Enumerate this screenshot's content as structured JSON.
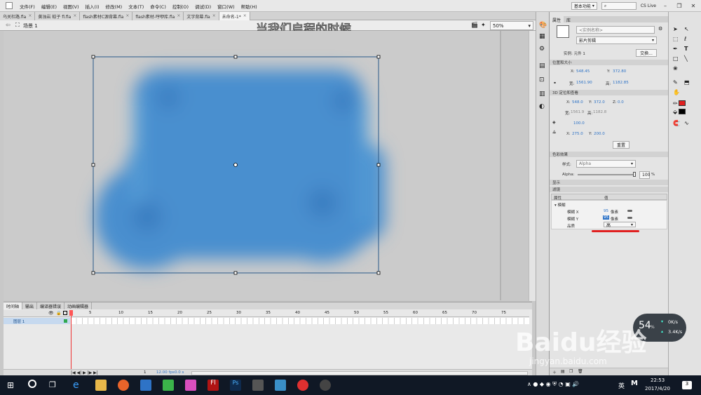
{
  "menubar": {
    "items": [
      "文件(F)",
      "编辑(E)",
      "视图(V)",
      "插入(I)",
      "修改(M)",
      "文本(T)",
      "命令(C)",
      "控制(O)",
      "调试(D)",
      "窗口(W)",
      "帮助(H)"
    ],
    "workspace": "基本功能",
    "search_placeholder": "",
    "cs_live": "CS Live"
  },
  "tabs": [
    {
      "label": "乌关杜路.fla",
      "active": false
    },
    {
      "label": "黄浊岩 蚊子 fl.fla",
      "active": false
    },
    {
      "label": "flash素材C源背幕.fla",
      "active": false
    },
    {
      "label": "flash素材-哼咿库.fla",
      "active": false
    },
    {
      "label": "文字背幕.fla",
      "active": false
    },
    {
      "label": "未命名-1*",
      "active": true
    }
  ],
  "scene": {
    "label": "场景 1",
    "overlay_title": "当我们启程的时候",
    "zoom": "50%"
  },
  "timeline": {
    "tabs": [
      "时间轴",
      "输出",
      "编译器错误",
      "动画编辑器"
    ],
    "layer_name": "图层 1",
    "frame_numbers": [
      "5",
      "10",
      "15",
      "20",
      "25",
      "30",
      "35",
      "40",
      "45",
      "50",
      "55",
      "60",
      "65",
      "70",
      "75"
    ],
    "status": {
      "frame": "1",
      "fps": "12.00 fps",
      "time": "0.0 s"
    }
  },
  "properties": {
    "tab_props": "属性",
    "tab_lib": "库",
    "instance_placeholder": "<实例名称>",
    "type": "影片剪辑",
    "instance_label": "实例: 元件 1",
    "swap_button": "交换...",
    "pos_section": "位置和大小",
    "x_label": "X:",
    "x_value": "548.45",
    "y_label": "Y:",
    "y_value": "372.80",
    "w_label": "宽:",
    "w_value": "1561.90",
    "h_label": "高:",
    "h_value": "1182.85",
    "three_d_section": "3D 定位和查看",
    "x3d": "548.0",
    "y3d": "372.0",
    "z3d": "0.0",
    "w3d": "1561.9",
    "h3d": "1182.8",
    "persp": "100.0",
    "vp_x": "275.0",
    "vp_y": "200.0",
    "reset_button": "重置",
    "color_section": "色彩效果",
    "style_label": "样式:",
    "style_value": "Alpha",
    "alpha_label": "Alpha:",
    "alpha_value": "100",
    "alpha_unit": "%",
    "display_section": "显示",
    "filters_section": "滤镜",
    "filter_col_prop": "属性",
    "filter_col_val": "值",
    "filter_name": "模糊",
    "blur_x_label": "模糊 X",
    "blur_x_value": "95",
    "blur_x_unit": "像素",
    "blur_y_label": "模糊 Y",
    "blur_y_value": "95",
    "blur_y_unit": "像素",
    "quality_label": "品质",
    "quality_value": "高"
  },
  "netwidget": {
    "percent": "54",
    "percent_unit": "%",
    "down": "0K/s",
    "up": "3.4K/s"
  },
  "watermark": {
    "brand": "Baidu经验",
    "url": "jingyan.baidu.com"
  },
  "taskbar": {
    "time": "22:53",
    "date": "2017/4/20",
    "lang": "英",
    "notif": "3"
  },
  "colors": {
    "accent": "#2e73c6",
    "blob": "#4a8fcf",
    "underline": "#e02020",
    "taskbar": "#101825"
  }
}
